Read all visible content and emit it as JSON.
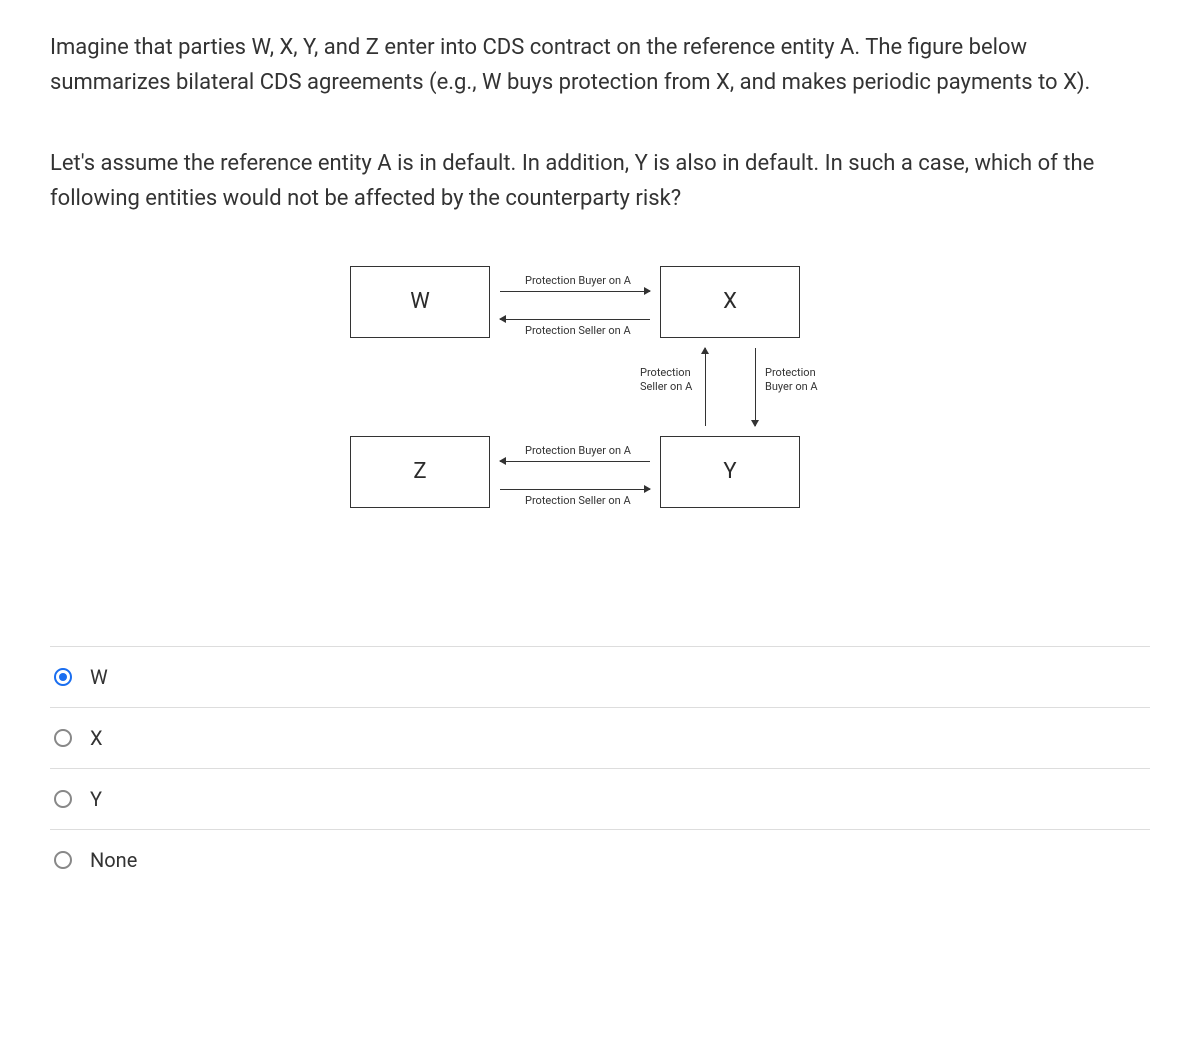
{
  "question": {
    "paragraph1": "Imagine that parties W, X, Y, and Z enter into CDS contract on the reference entity A. The figure below summarizes bilateral CDS agreements (e.g., W buys protection from X, and makes periodic payments to X).",
    "paragraph2": "Let's assume the reference entity A is in default. In addition, Y is also in default. In such a case, which of the following entities would not be affected by the counterparty risk?"
  },
  "diagram": {
    "nodes": {
      "w": "W",
      "x": "X",
      "y": "Y",
      "z": "Z"
    },
    "labels": {
      "wx_top": "Protection Buyer on A",
      "wx_bottom": "Protection Seller on A",
      "zy_top": "Protection Buyer on A",
      "zy_bottom": "Protection Seller on A",
      "xy_left": "Protection Seller on A",
      "xy_right": "Protection Buyer on A"
    }
  },
  "options": [
    {
      "label": "W",
      "selected": true
    },
    {
      "label": "X",
      "selected": false
    },
    {
      "label": "Y",
      "selected": false
    },
    {
      "label": "None",
      "selected": false
    }
  ]
}
